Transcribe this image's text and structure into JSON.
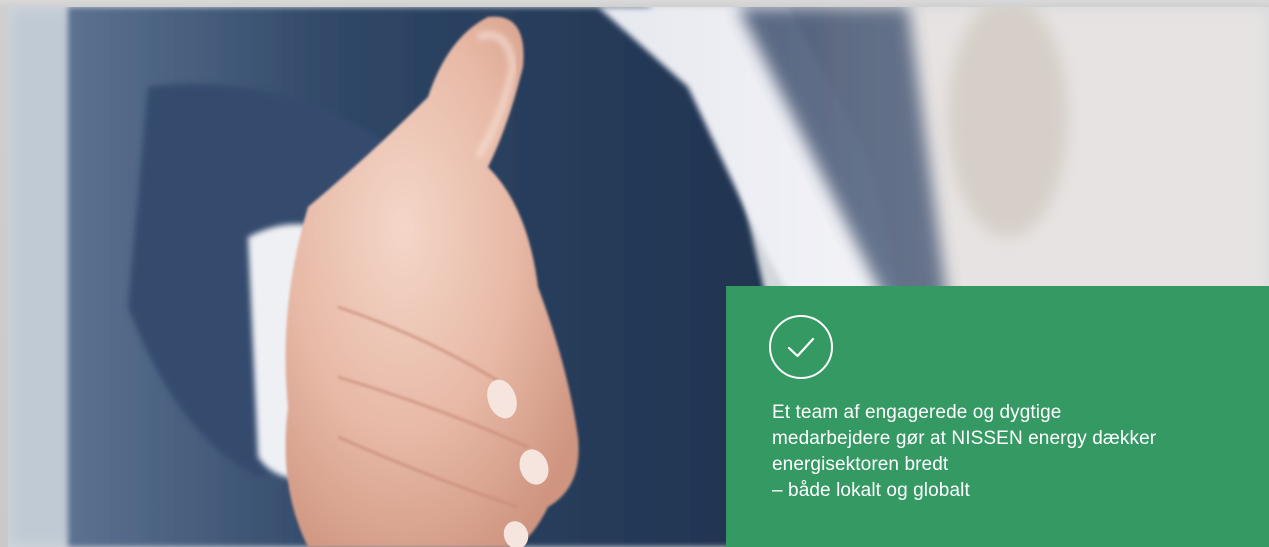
{
  "photo": {
    "subject": "business-person-offering-handshake"
  },
  "panel": {
    "icon": "check-circle-icon",
    "background_color": "#359964",
    "text_color": "#ffffff",
    "lines": [
      "Et team af engagerede og dygtige",
      "medarbejdere gør at NISSEN energy dækker",
      "energisektoren bredt",
      "– både lokalt og globalt"
    ]
  }
}
